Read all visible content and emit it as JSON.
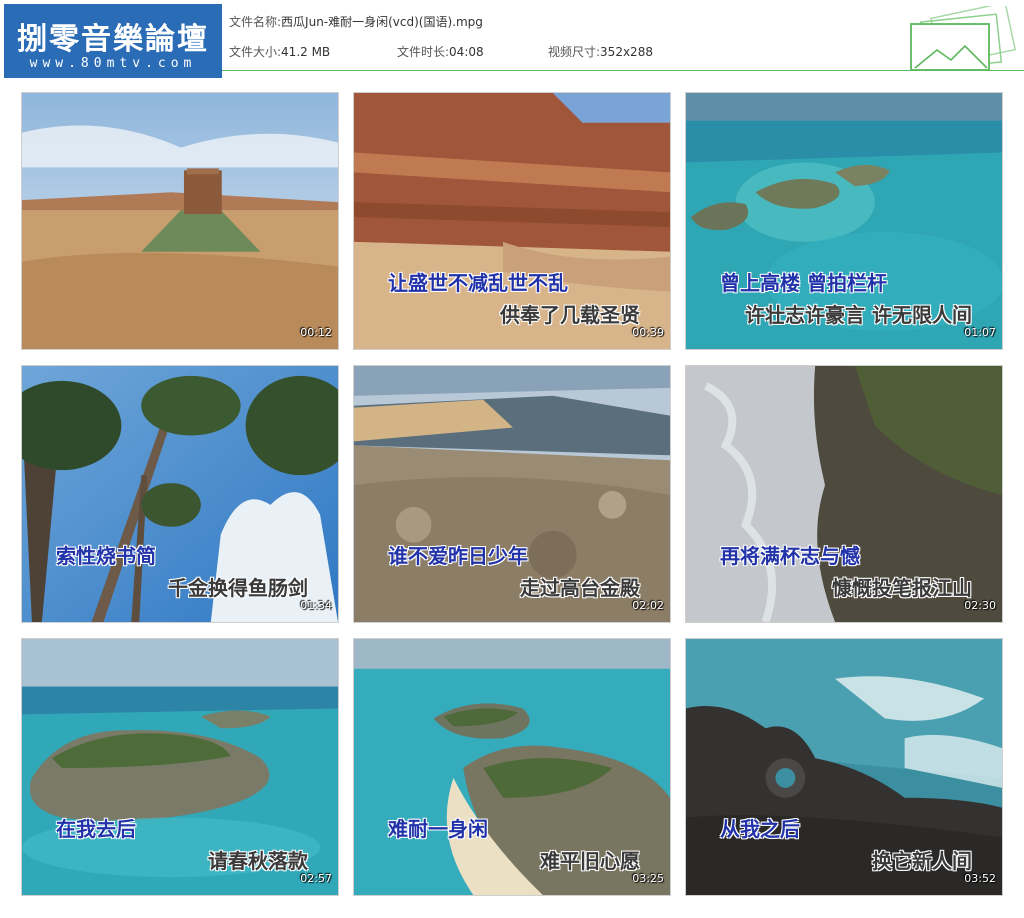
{
  "logo": {
    "title": "捌零音樂論壇",
    "url": "www.80mtv.com"
  },
  "file_info": {
    "name_label": "文件名称:",
    "name_value": "西瓜Jun-难耐一身闲(vcd)(国语).mpg",
    "size_label": "文件大小:",
    "size_value": "41.2 MB",
    "duration_label": "文件时长:",
    "duration_value": "04:08",
    "dims_label": "视频尺寸:",
    "dims_value": "352x288"
  },
  "thumbnails": [
    {
      "time": "00:12",
      "line1": "",
      "line2": "",
      "scene": "desert-butte"
    },
    {
      "time": "00:39",
      "line1": "让盛世不减乱世不乱",
      "line2": "供奉了几载圣贤",
      "scene": "canyon"
    },
    {
      "time": "01:07",
      "line1": "曾上高楼 曾拍栏杆",
      "line2": "许壮志许豪言 许无限人间",
      "scene": "sea-islands"
    },
    {
      "time": "01:34",
      "line1": "索性烧书简",
      "line2": "千金换得鱼肠剑",
      "scene": "pine-sky"
    },
    {
      "time": "02:02",
      "line1": "谁不爱昨日少年",
      "line2": "走过高台金殿",
      "scene": "rocky-hill"
    },
    {
      "time": "02:30",
      "line1": "再将满杯志与憾",
      "line2": "慷慨投笔报江山",
      "scene": "cliff-waves"
    },
    {
      "time": "02:57",
      "line1": "在我去后",
      "line2": "请春秋落款",
      "scene": "island"
    },
    {
      "time": "03:25",
      "line1": "难耐一身闲",
      "line2": "难平旧心愿",
      "scene": "island-beach"
    },
    {
      "time": "03:52",
      "line1": "从我之后",
      "line2": "换它新人间",
      "scene": "rocks-surf"
    }
  ]
}
